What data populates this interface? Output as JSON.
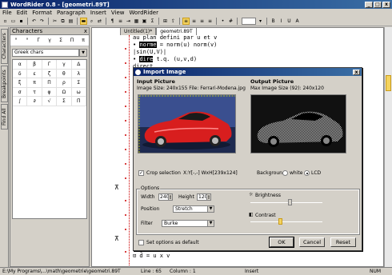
{
  "window": {
    "title": "WordRider 0.8 - [geometri.89T]"
  },
  "menu": [
    "File",
    "Edit",
    "Format",
    "Paragraph",
    "Insert",
    "View",
    "WordRider"
  ],
  "left_tabs": {
    "characters": "Characters",
    "breakpoints": "Breakpoints",
    "find_all": "Find All"
  },
  "char_panel": {
    "title": "Characters",
    "symbols": [
      "°",
      "°",
      "Γ",
      "γ",
      "Σ",
      "Π",
      "π"
    ],
    "set_selected": "Greek chars",
    "chars": [
      "α",
      "β",
      "Γ",
      "γ",
      "Δ",
      "δ",
      "ε",
      "ζ",
      "θ",
      "λ",
      "ξ",
      "π",
      "Π",
      "ρ",
      "Σ",
      "σ",
      "τ",
      "φ",
      "Ω",
      "ω",
      "∫",
      "∂",
      "√",
      "Σ",
      "Π"
    ]
  },
  "editor": {
    "tabs": [
      "Untitled(1)*",
      "geometri.89T"
    ],
    "lines": [
      {
        "text": "au plan defini par u et v"
      },
      {
        "pre": "• ",
        "hl": "norme",
        "post": " = norm(u) norm(v)"
      },
      {
        "text": "|sin(U,V)|"
      },
      {
        "pre": "• ",
        "hl": "dire",
        "post": " t.q. (u,v,d)"
      },
      {
        "text": "direct"
      }
    ],
    "bottom_line": "⊡ d̂ = u x v"
  },
  "dialog": {
    "title": "Import Image",
    "input_heading": "Input Picture",
    "input_info": "Image Size: 240x155   File: Ferrari-Modena.jpg",
    "output_heading": "Output Picture",
    "output_info": "Max Image Size (92): 240x120",
    "crop_label": "Crop selection",
    "crop_coords": "X:Y[-,-] WxH[239x124]",
    "background_label": "Background",
    "white_label": "white",
    "lcd_label": "LCD",
    "options_heading": "Options",
    "width_label": "Width",
    "width_value": "240",
    "height_label": "Height",
    "height_value": "120",
    "position_label": "Position",
    "position_value": "Stretch",
    "filter_label": "Filter",
    "filter_value": "Burke",
    "brightness_label": "Brightness",
    "brightness_level": 0.55,
    "contrast_label": "Contrast",
    "contrast_level": 0.42,
    "set_default_label": "Set options as default",
    "ok": "OK",
    "cancel": "Cancel",
    "reset": "Reset"
  },
  "status": {
    "path": "E:\\My Programs\\...\\math\\geometrie\\geometri.89T",
    "line": "Line : 65",
    "column": "Column : 1",
    "mode": "Insert",
    "num": "NUM"
  },
  "colors": {
    "title_start": "#0a246a",
    "title_end": "#3a6ea5",
    "accent": "#f4d35e",
    "car_red": "#d81e1e"
  }
}
